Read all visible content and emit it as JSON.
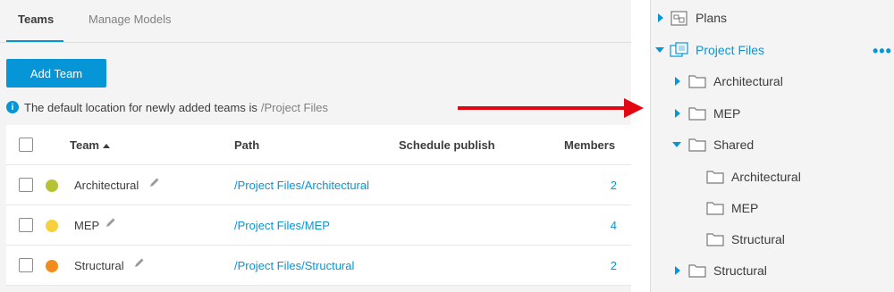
{
  "tabs": [
    {
      "label": "Teams",
      "active": true
    },
    {
      "label": "Manage Models",
      "active": false
    }
  ],
  "add_team_label": "Add Team",
  "info": {
    "text": "The default location for newly added teams is",
    "path": "/Project Files"
  },
  "table": {
    "headers": {
      "team": "Team",
      "path": "Path",
      "schedule": "Schedule publish",
      "members": "Members"
    },
    "rows": [
      {
        "team": "Architectural",
        "path": "/Project Files/Architectural",
        "members": "2",
        "color": "#b5c334"
      },
      {
        "team": "MEP",
        "path": "/Project Files/MEP",
        "members": "4",
        "color": "#f7d13c"
      },
      {
        "team": "Structural",
        "path": "/Project Files/Structural",
        "members": "2",
        "color": "#f28c1c"
      }
    ]
  },
  "tree": {
    "plans": "Plans",
    "project_files": "Project Files",
    "more": "•••",
    "folders": [
      {
        "label": "Architectural",
        "expanded": false
      },
      {
        "label": "MEP",
        "expanded": false
      },
      {
        "label": "Shared",
        "expanded": true
      },
      {
        "label": "Structural",
        "expanded": false
      }
    ],
    "shared_children": [
      "Architectural",
      "MEP",
      "Structural"
    ]
  },
  "colors": {
    "accent": "#0696d7",
    "arrow": "#e30613"
  }
}
